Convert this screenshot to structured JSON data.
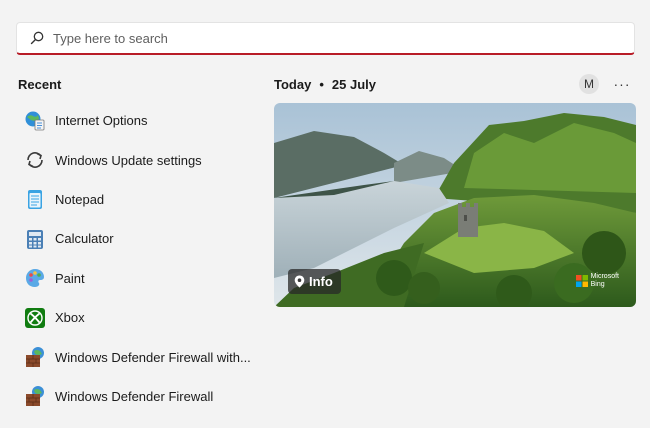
{
  "search": {
    "placeholder": "Type here to search",
    "accent": "#b81c27"
  },
  "recent": {
    "title": "Recent",
    "items": [
      {
        "label": "Internet Options",
        "icon": "internet-options-icon"
      },
      {
        "label": "Windows Update settings",
        "icon": "windows-update-icon"
      },
      {
        "label": "Notepad",
        "icon": "notepad-icon"
      },
      {
        "label": "Calculator",
        "icon": "calculator-icon"
      },
      {
        "label": "Paint",
        "icon": "paint-icon"
      },
      {
        "label": "Xbox",
        "icon": "xbox-icon"
      },
      {
        "label": "Windows Defender Firewall with...",
        "icon": "firewall-icon"
      },
      {
        "label": "Windows Defender Firewall",
        "icon": "firewall-icon"
      }
    ]
  },
  "today": {
    "label": "Today",
    "separator": "•",
    "date": "25 July"
  },
  "account": {
    "initial": "M"
  },
  "more_label": "···",
  "photo": {
    "info_label": "Info",
    "credit_line1": "Microsoft",
    "credit_line2": "Bing"
  }
}
